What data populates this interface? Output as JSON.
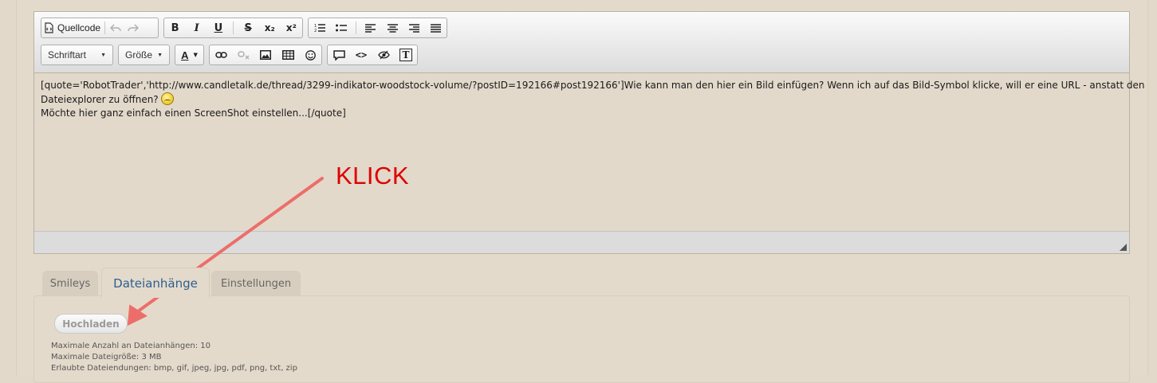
{
  "toolbar": {
    "source_label": "Quellcode",
    "font_dropdown": "Schriftart",
    "size_dropdown": "Größe",
    "bold": "B",
    "italic": "I",
    "underline": "U",
    "strike": "S",
    "subscript": "x₂",
    "superscript": "x²",
    "font_color": "A",
    "code_inline": "<>",
    "tt": "T"
  },
  "editor": {
    "line1": "[quote='RobotTrader','http://www.candletalk.de/thread/3299-indikator-woodstock-volume/?postID=192166#post192166']Wie kann man den hier ein Bild einfügen? Wenn ich auf das Bild-Symbol klicke, will er eine URL - anstatt den",
    "line2": "Dateiexplorer zu öffnen?",
    "line3": "Möchte hier ganz einfach einen ScreenShot einstellen...[/quote]"
  },
  "annotation": {
    "text": "KLICK",
    "color": "#e00000"
  },
  "tabs": [
    {
      "label": "Smileys",
      "active": false
    },
    {
      "label": "Dateianhänge",
      "active": true
    },
    {
      "label": "Einstellungen",
      "active": false
    }
  ],
  "attachments": {
    "upload_label": "Hochladen",
    "max_count": "Maximale Anzahl an Dateianhängen: 10",
    "max_size": "Maximale Dateigröße: 3 MB",
    "allowed_ext": "Erlaubte Dateiendungen: bmp, gif, jpeg, jpg, pdf, png, txt, zip"
  }
}
